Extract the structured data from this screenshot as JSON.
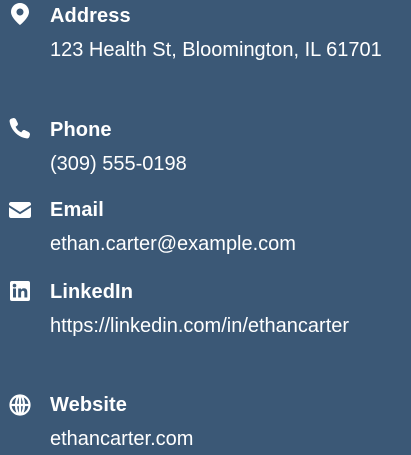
{
  "contact": {
    "address": {
      "label": "Address",
      "value": "123 Health St, Bloomington, IL 61701",
      "icon": "map-pin-icon"
    },
    "phone": {
      "label": "Phone",
      "value": "(309) 555-0198",
      "icon": "phone-icon"
    },
    "email": {
      "label": "Email",
      "value": "ethan.carter@example.com",
      "icon": "envelope-icon"
    },
    "linkedin": {
      "label": "LinkedIn",
      "value": "https://linkedin.com/in/ethancarter",
      "icon": "linkedin-icon"
    },
    "website": {
      "label": "Website",
      "value": "ethancarter.com",
      "icon": "globe-icon"
    }
  },
  "colors": {
    "background": "#3b5876",
    "text": "#ffffff"
  }
}
